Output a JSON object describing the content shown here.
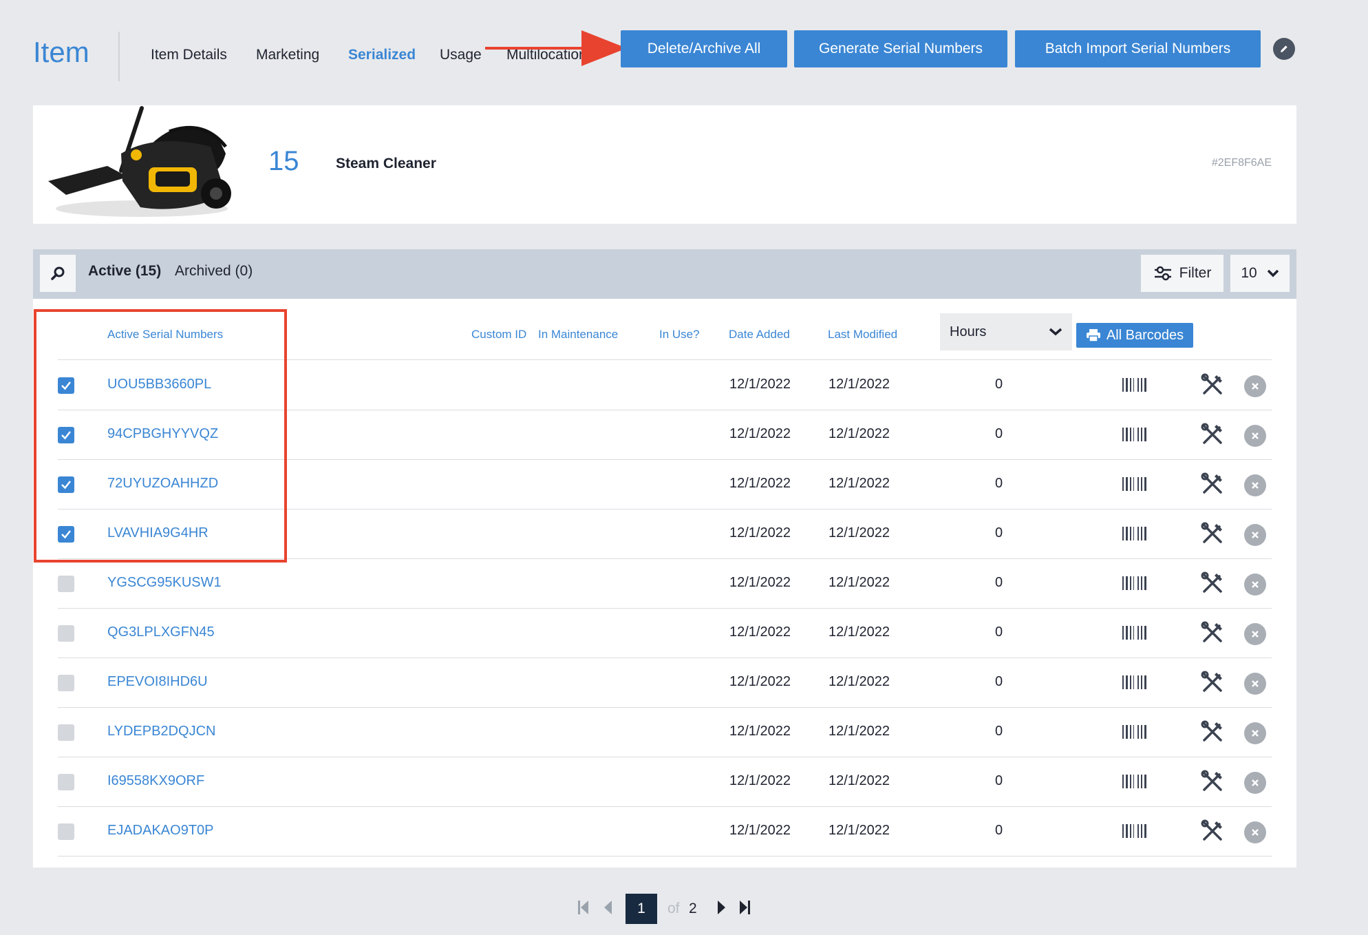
{
  "header": {
    "title": "Item",
    "tabs": [
      "Item Details",
      "Marketing",
      "Serialized",
      "Usage",
      "Multilocation"
    ],
    "active_tab": "Serialized",
    "buttons": {
      "delete_archive": "Delete/Archive All",
      "generate": "Generate Serial Numbers",
      "batch_import": "Batch Import Serial Numbers"
    }
  },
  "item": {
    "count": "15",
    "name": "Steam Cleaner",
    "hash": "#2EF8F6AE"
  },
  "toolbar": {
    "active_tab": "Active (15)",
    "archived_tab": "Archived (0)",
    "filter_label": "Filter",
    "page_size": "10"
  },
  "table": {
    "columns": {
      "serial": "Active Serial Numbers",
      "custom_id": "Custom ID",
      "in_maintenance": "In Maintenance",
      "in_use": "In Use?",
      "date_added": "Date Added",
      "last_modified": "Last Modified"
    },
    "units_select": "Hours",
    "all_barcodes": "All Barcodes",
    "rows": [
      {
        "serial": "UOU5BB3660PL",
        "checked": true,
        "date_added": "12/1/2022",
        "last_modified": "12/1/2022",
        "hours": "0"
      },
      {
        "serial": "94CPBGHYYVQZ",
        "checked": true,
        "date_added": "12/1/2022",
        "last_modified": "12/1/2022",
        "hours": "0"
      },
      {
        "serial": "72UYUZOAHHZD",
        "checked": true,
        "date_added": "12/1/2022",
        "last_modified": "12/1/2022",
        "hours": "0"
      },
      {
        "serial": "LVAVHIA9G4HR",
        "checked": true,
        "date_added": "12/1/2022",
        "last_modified": "12/1/2022",
        "hours": "0"
      },
      {
        "serial": "YGSCG95KUSW1",
        "checked": false,
        "date_added": "12/1/2022",
        "last_modified": "12/1/2022",
        "hours": "0"
      },
      {
        "serial": "QG3LPLXGFN45",
        "checked": false,
        "date_added": "12/1/2022",
        "last_modified": "12/1/2022",
        "hours": "0"
      },
      {
        "serial": "EPEVOI8IHD6U",
        "checked": false,
        "date_added": "12/1/2022",
        "last_modified": "12/1/2022",
        "hours": "0"
      },
      {
        "serial": "LYDEPB2DQJCN",
        "checked": false,
        "date_added": "12/1/2022",
        "last_modified": "12/1/2022",
        "hours": "0"
      },
      {
        "serial": "I69558KX9ORF",
        "checked": false,
        "date_added": "12/1/2022",
        "last_modified": "12/1/2022",
        "hours": "0"
      },
      {
        "serial": "EJADAKAO9T0P",
        "checked": false,
        "date_added": "12/1/2022",
        "last_modified": "12/1/2022",
        "hours": "0"
      }
    ]
  },
  "pagination": {
    "current": "1",
    "of_label": "of",
    "total": "2"
  },
  "colors": {
    "accent": "#3a86d4",
    "annotation": "#e8432f",
    "page_bg": "#e8e9ec",
    "toolbar_bg": "#c8d1db"
  },
  "icons": [
    "edit-icon",
    "search-icon",
    "filter-icon",
    "chevron-down-icon",
    "printer-icon",
    "check-icon",
    "barcode-icon",
    "tools-icon",
    "close-icon",
    "first-page-icon",
    "prev-page-icon",
    "next-page-icon",
    "last-page-icon"
  ]
}
